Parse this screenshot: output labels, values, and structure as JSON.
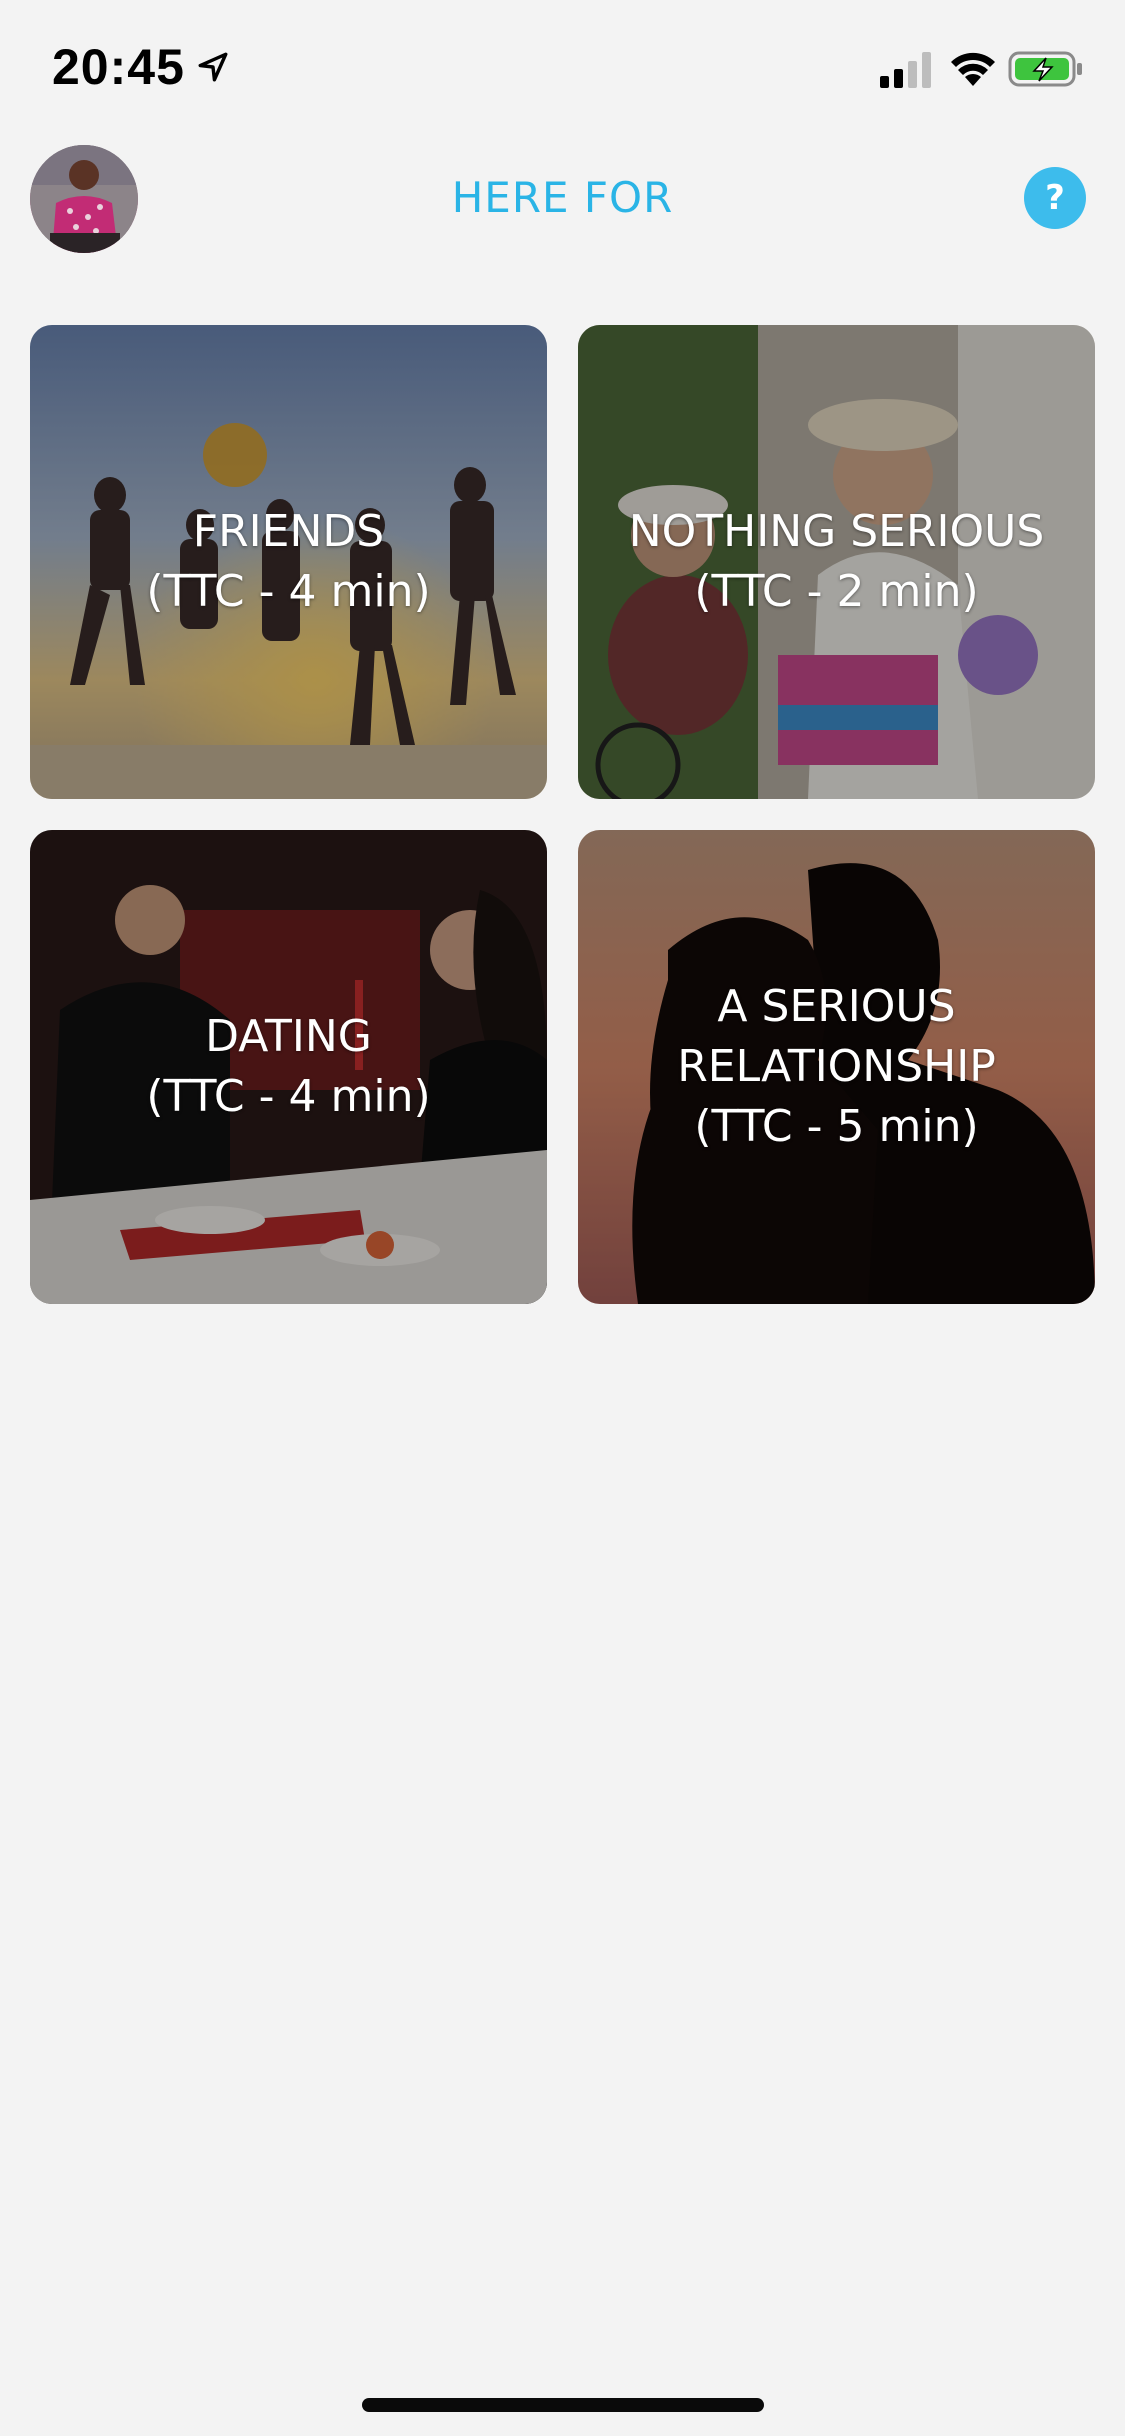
{
  "status_bar": {
    "time": "20:45",
    "icons": [
      "location-icon",
      "signal-icon",
      "wifi-icon",
      "battery-charging-icon"
    ]
  },
  "header": {
    "title": "HERE FOR",
    "help_label": "?",
    "avatar": "profile-avatar"
  },
  "colors": {
    "accent": "#2ab4e6",
    "help_bg": "#3dbcec",
    "background": "#f3f3f3",
    "battery_green": "#3ec43e"
  },
  "cards": [
    {
      "line1": "FRIENDS",
      "line2": "",
      "line3": "(TTC - 4 min)"
    },
    {
      "line1": "NOTHING SERIOUS",
      "line2": "",
      "line3": "(TTC - 2 min)"
    },
    {
      "line1": "DATING",
      "line2": "",
      "line3": "(TTC - 4 min)"
    },
    {
      "line1": "A SERIOUS",
      "line2": "RELATIONSHIP",
      "line3": "(TTC - 5 min)"
    }
  ]
}
